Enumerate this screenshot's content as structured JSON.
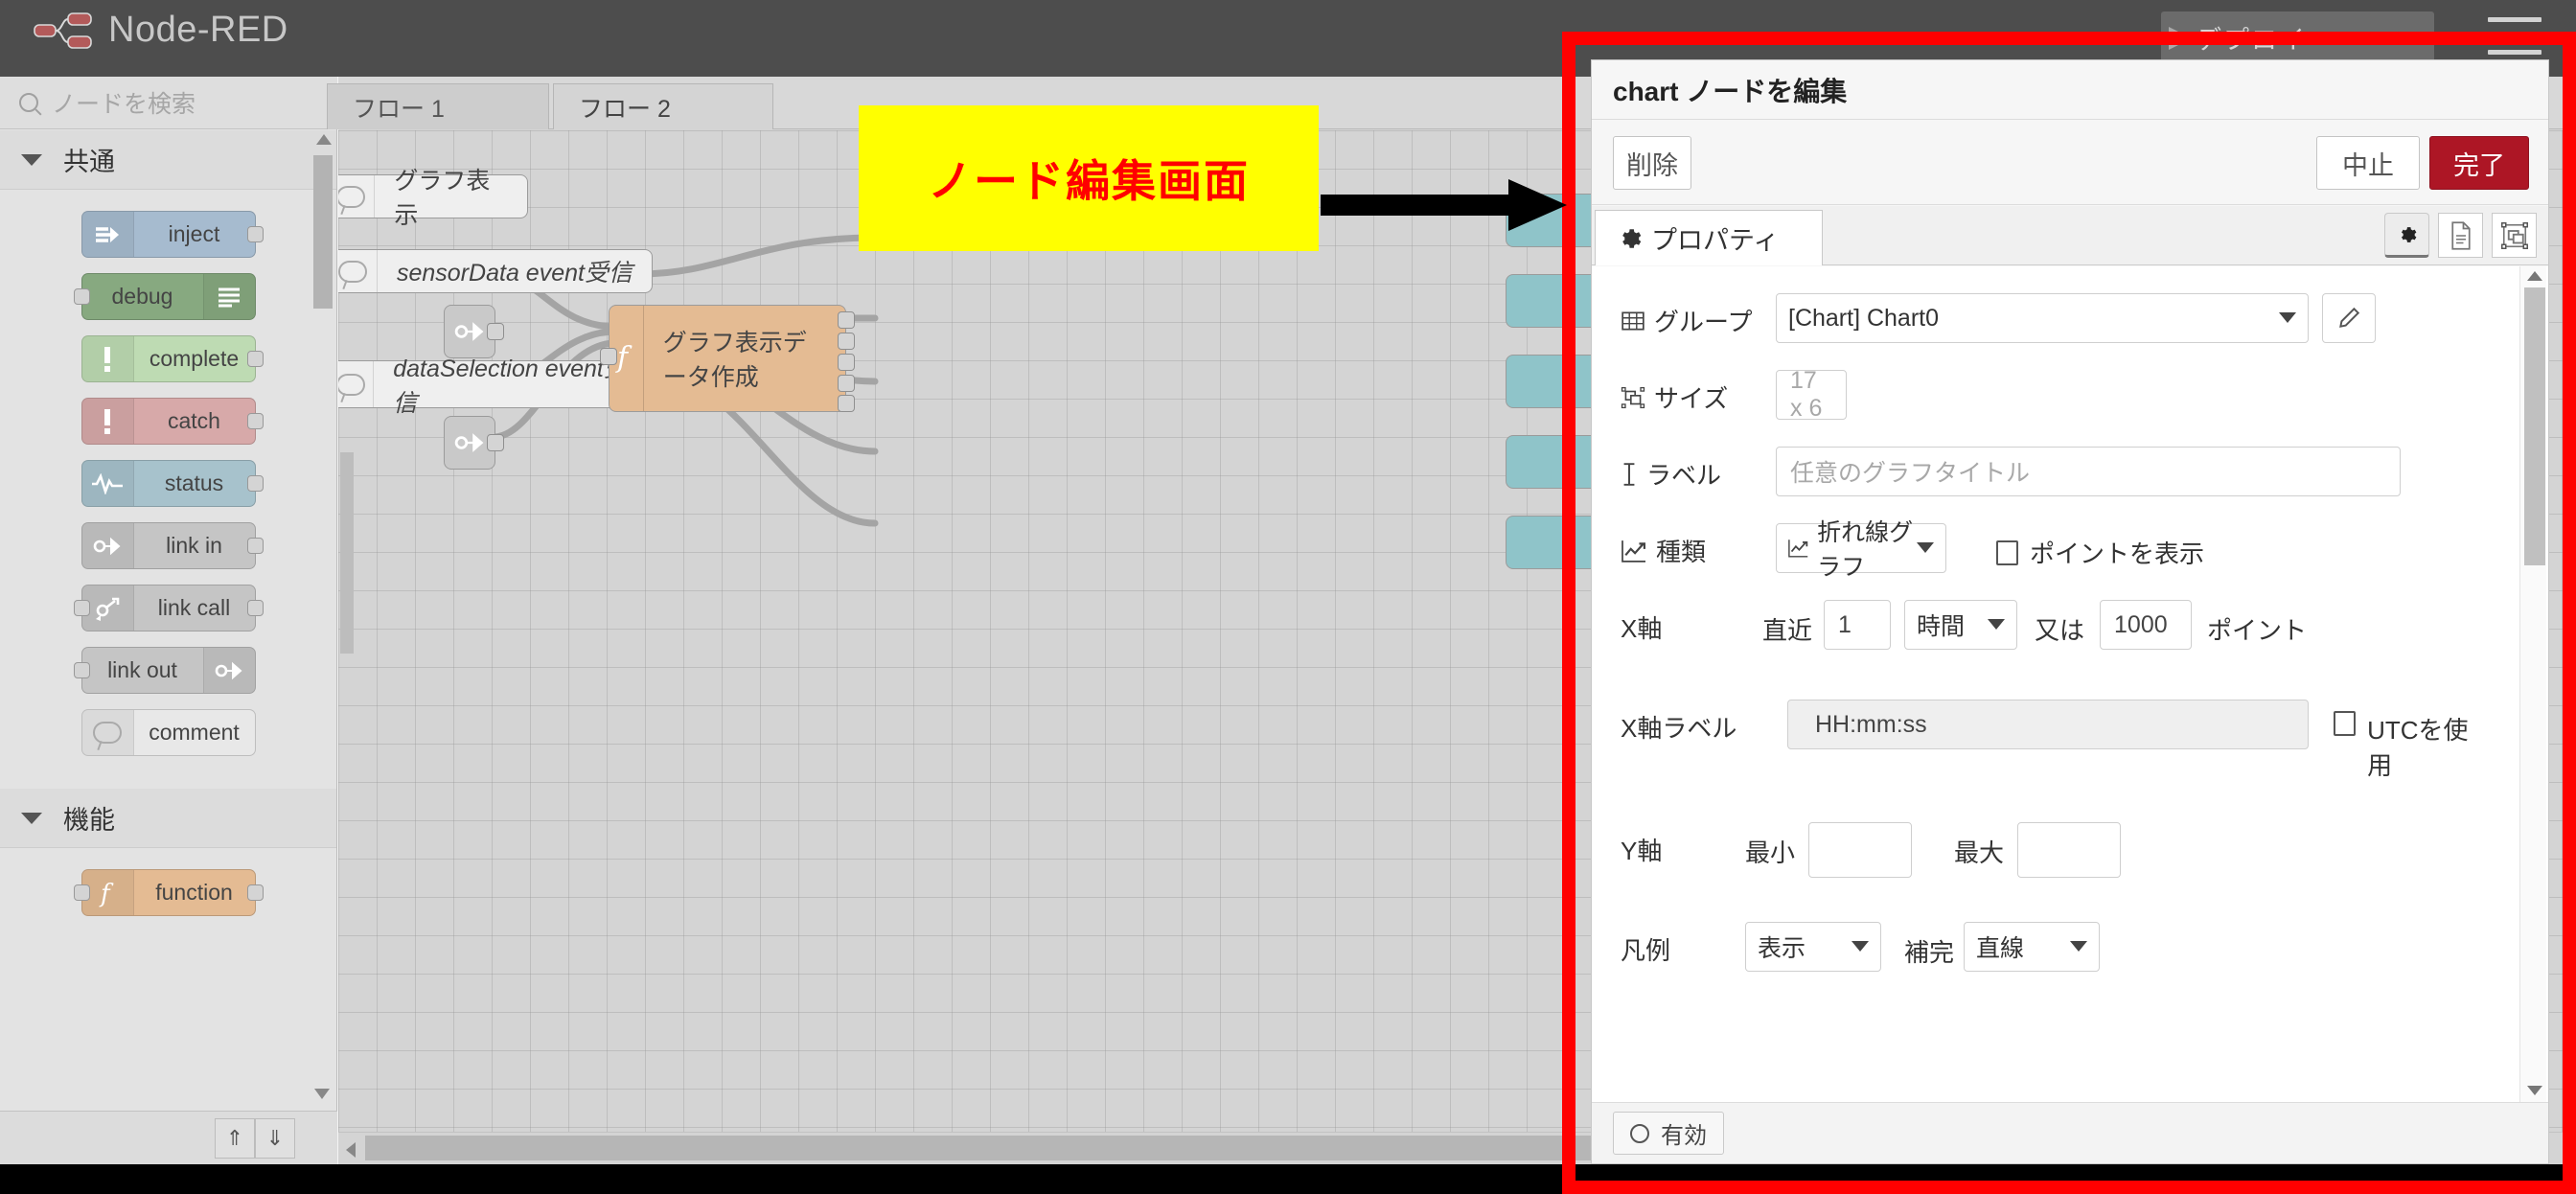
{
  "app": {
    "title": "Node-RED",
    "deploy_label": "デプロイ",
    "menu_icon": "hamburger-menu-icon",
    "logo_icon": "node-red-logo-icon"
  },
  "palette": {
    "search_placeholder": "ノードを検索",
    "search_icon": "search-icon",
    "categories": [
      {
        "label": "共通",
        "nodes": [
          {
            "label": "inject",
            "icon": "inject-icon",
            "color": "#a6bbcf",
            "ports": "out"
          },
          {
            "label": "debug",
            "icon": "debug-icon",
            "color": "#87a980",
            "ports": "in",
            "icon_side": "right"
          },
          {
            "label": "complete",
            "icon": "complete-icon",
            "color": "#bedbb3",
            "ports": "out"
          },
          {
            "label": "catch",
            "icon": "catch-icon",
            "color": "#d7a9a9",
            "ports": "out"
          },
          {
            "label": "status",
            "icon": "status-icon",
            "color": "#a7c2cc",
            "ports": "out"
          },
          {
            "label": "link in",
            "icon": "link-in-icon",
            "color": "#c5c5c5",
            "ports": "out"
          },
          {
            "label": "link call",
            "icon": "link-call-icon",
            "color": "#c5c5c5",
            "ports": "both"
          },
          {
            "label": "link out",
            "icon": "link-out-icon",
            "color": "#c5c5c5",
            "ports": "in",
            "icon_side": "right"
          },
          {
            "label": "comment",
            "icon": "comment-icon",
            "color": "#e8e8e8",
            "ports": "none"
          }
        ]
      },
      {
        "label": "機能",
        "nodes": [
          {
            "label": "function",
            "icon": "function-icon",
            "color": "#e4bb93",
            "ports": "both"
          }
        ]
      }
    ],
    "footer": {
      "collapse_all_icon": "chevron-double-up-icon",
      "expand_all_icon": "chevron-double-down-icon"
    }
  },
  "workspace": {
    "tabs": [
      {
        "label": "フロー 1",
        "active": false
      },
      {
        "label": "フロー 2",
        "active": true
      }
    ],
    "nodes": [
      {
        "name": "graph-display-comment",
        "label": "グラフ表示",
        "type": "comment",
        "italic": false
      },
      {
        "name": "sensordata-comment",
        "label": "sensorData event受信",
        "type": "comment",
        "italic": true
      },
      {
        "name": "dataselection-comment",
        "label": "dataSelection event受信",
        "type": "comment",
        "italic": true
      },
      {
        "name": "function-node",
        "label": "グラフ表示データ作成",
        "type": "function",
        "italic": false
      }
    ],
    "link_nodes": [
      {
        "name": "link-in-node-top"
      },
      {
        "name": "link-in-node-bottom"
      }
    ]
  },
  "annotation": {
    "text": "ノード編集画面",
    "bg_color": "#ffff00",
    "text_color": "#ff0000",
    "arrow_icon": "right-arrow-icon",
    "frame_color": "#ff0000"
  },
  "dialog": {
    "title": "chart ノードを編集",
    "buttons": {
      "delete": "削除",
      "cancel": "中止",
      "done": "完了"
    },
    "tabs": {
      "properties": "プロパティ",
      "properties_icon": "gear-icon",
      "icons": [
        {
          "name": "gear-icon",
          "selected": true
        },
        {
          "name": "description-icon",
          "selected": false
        },
        {
          "name": "appearance-icon",
          "selected": false
        }
      ]
    },
    "fields": {
      "group": {
        "label": "グループ",
        "icon": "grid-icon",
        "value": "[Chart] Chart0",
        "edit_icon": "pencil-icon"
      },
      "size": {
        "label": "サイズ",
        "icon": "resize-icon",
        "value": "17 x 6"
      },
      "label": {
        "label": "ラベル",
        "icon": "text-cursor-icon",
        "placeholder": "任意のグラフタイトル",
        "value": ""
      },
      "type": {
        "label": "種類",
        "icon": "line-chart-icon",
        "value": "折れ線グラフ",
        "value_icon": "line-chart-icon",
        "checkbox_label": "ポイントを表示",
        "checkbox_checked": false
      },
      "xaxis": {
        "label": "X軸",
        "prefix": "直近",
        "count": "1",
        "unit": "時間",
        "or": "又は",
        "points": "1000",
        "suffix": "ポイント"
      },
      "xlabel": {
        "label": "X軸ラベル",
        "value": "HH:mm:ss",
        "dropdown_icon": "caret-down-icon",
        "checkbox_label": "UTCを使用",
        "checkbox_checked": false
      },
      "yaxis": {
        "label": "Y軸",
        "min_label": "最小",
        "min_value": "",
        "max_label": "最大",
        "max_value": ""
      },
      "legend": {
        "label": "凡例",
        "value": "表示",
        "interp_label": "補完",
        "interp_value": "直線"
      }
    },
    "footer": {
      "enabled_label": "有効",
      "enabled_icon": "circle-icon"
    }
  },
  "colors": {
    "accent_red": "#ad1625",
    "header_gray": "#4d4d4d",
    "canvas_gray": "#d4d4d4",
    "function_node": "#e4bb93",
    "teal_node": "#8fc4c9"
  }
}
